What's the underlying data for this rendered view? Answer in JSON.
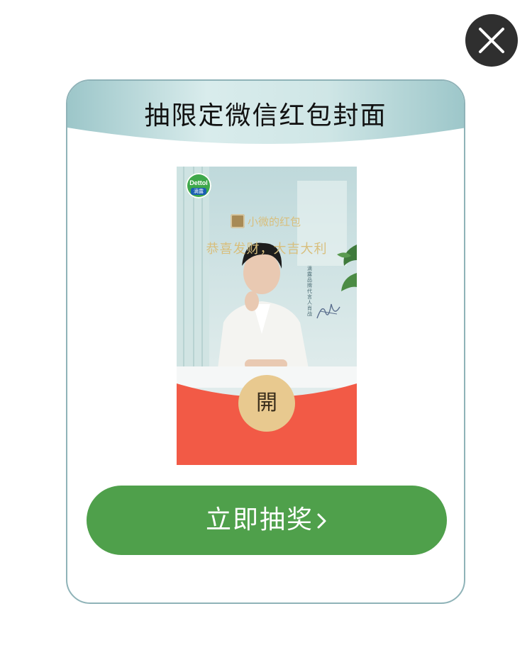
{
  "modal": {
    "title": "抽限定微信红包封面",
    "cover": {
      "brand": "Dettol",
      "brand_sub": "滴露",
      "sender": "小微的红包",
      "greeting": "恭喜发财，大吉大利",
      "endorse_text": "滴露品牌代言人 肖战",
      "open_label": "開"
    },
    "cta": "立即抽奖"
  },
  "icons": {
    "close": "close-icon",
    "chevron": "chevron-right-icon"
  },
  "colors": {
    "accent_green": "#4fa04b",
    "envelope_red": "#f25a46",
    "open_button_gold": "#e8c98f",
    "header_teal": "#a9cfd2",
    "close_bg": "#2f2f2f"
  }
}
